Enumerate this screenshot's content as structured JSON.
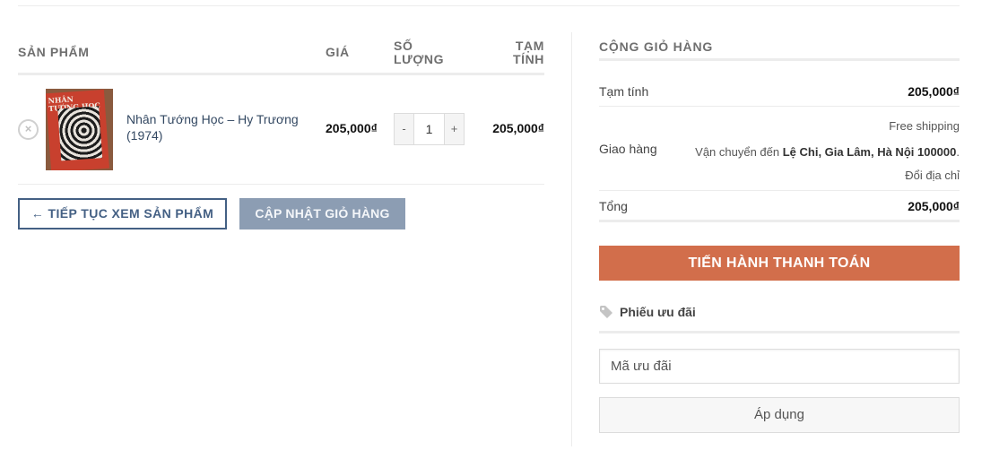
{
  "cart": {
    "headers": {
      "product": "SẢN PHẨM",
      "price": "GIÁ",
      "quantity_line1": "SỐ",
      "quantity_line2": "LƯỢNG",
      "subtotal_line1": "TẠM",
      "subtotal_line2": "TÍNH"
    },
    "items": [
      {
        "remove_symbol": "×",
        "thumbnail_title": "NHÂN TƯỚNG HỌC",
        "name": "Nhân Tướng Học – Hy Trương (1974)",
        "price": "205,000₫",
        "quantity": "1",
        "minus_label": "-",
        "plus_label": "+",
        "subtotal": "205,000₫"
      }
    ],
    "continue_button": "← TIẾP TỤC XEM SẢN PHẨM",
    "update_button": "CẬP NHẬT GIỎ HÀNG"
  },
  "totals": {
    "title": "CỘNG GIỎ HÀNG",
    "subtotal_label": "Tạm tính",
    "subtotal_value": "205,000₫",
    "shipping_label": "Giao hàng",
    "shipping_method": "Free shipping",
    "shipping_to_prefix": "Vận chuyển đến ",
    "shipping_address": "Lệ Chi, Gia Lâm, Hà Nội 100000",
    "shipping_to_suffix": ".",
    "change_address": "Đổi địa chỉ",
    "total_label": "Tổng",
    "total_value": "205,000₫",
    "checkout_button": "TIẾN HÀNH THANH TOÁN"
  },
  "coupon": {
    "icon": "tag-icon",
    "title": "Phiếu ưu đãi",
    "input_value": "",
    "input_placeholder": "Mã ưu đãi",
    "apply_button": "Áp dụng"
  },
  "colors": {
    "checkout": "#d26e4b",
    "primary": "#446084",
    "update_button": "#8c9db3"
  }
}
